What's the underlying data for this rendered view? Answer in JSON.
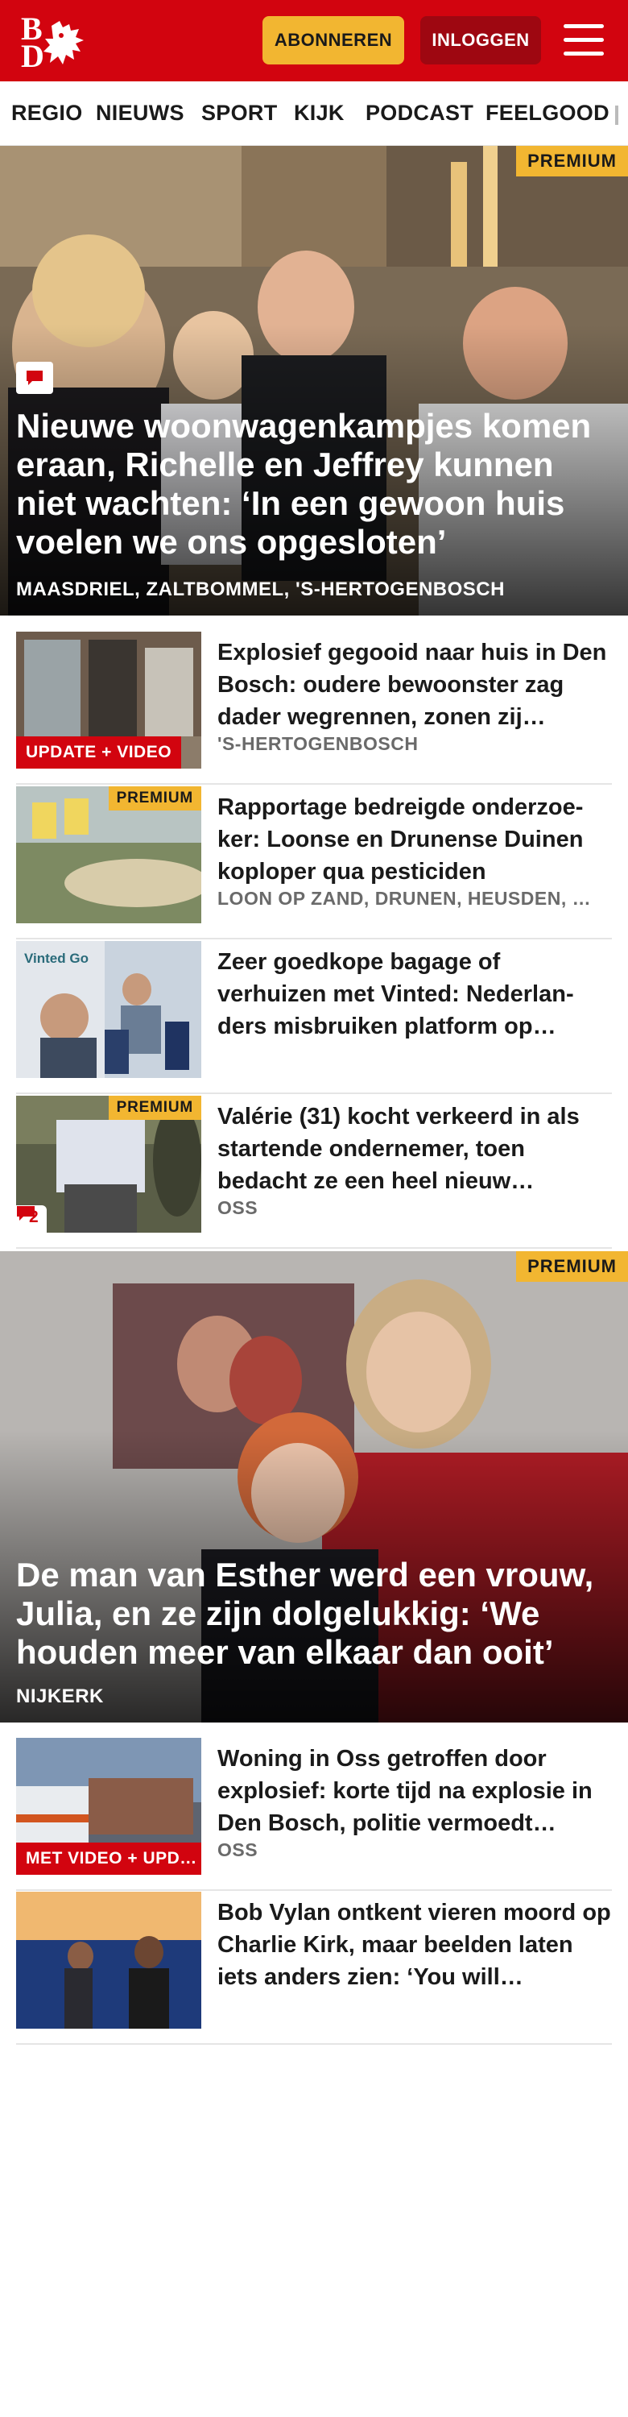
{
  "header": {
    "logo_b": "B",
    "logo_d": "D",
    "subscribe_label": "ABONNEREN",
    "login_label": "INLOGGEN",
    "menu_icon": "hamburger-icon",
    "brand_color": "#d2040f",
    "accent_color": "#f2b631"
  },
  "nav": {
    "items": [
      "REGIO",
      "NIEUWS",
      "SPORT",
      "KIJK",
      "PODCAST",
      "FEELGOOD"
    ]
  },
  "hero1": {
    "badge": "PREMIUM",
    "title": "Nieuwe woonwagenkampjes komen eraan, Richelle en Jeffrey kunnen niet wachten: ‘In een gewoon huis voelen we ons opgesloten’",
    "location": "MAASDRIEL, ZALTBOMMEL, 'S-HERTOGENBOSCH",
    "comment_icon": "comment-icon"
  },
  "list1": [
    {
      "title": "Explosief gegooid naar huis in Den Bosch: oudere bewoonster zag dader wegrennen, zonen zij…",
      "location": "'S-HERTOGENBOSCH",
      "label": "UPDATE + VIDEO"
    },
    {
      "title": "Rapportage bedreigde onderzoe-ker: Loonse en Drunense Duinen koploper qua pesticiden",
      "location": "LOON OP ZAND, DRUNEN, HEUSDEN, …",
      "badge": "PREMIUM"
    },
    {
      "title": "Zeer goedkope bagage of verhuizen met Vinted: Nederlan-ders misbruiken platform op…",
      "thumb_text": "Vinted Go"
    },
    {
      "title": "Valérie (31) kocht verkeerd in als startende ondernemer, toen bedacht ze een heel nieuw…",
      "location": "OSS",
      "badge": "PREMIUM",
      "comments": "2"
    }
  ],
  "hero2": {
    "badge": "PREMIUM",
    "title": "De man van Esther werd een vrouw, Julia, en ze zijn dolgelukkig: ‘We houden meer van elkaar dan ooit’",
    "location": "NIJKERK"
  },
  "list2": [
    {
      "title": "Woning in Oss getroffen door explosief: korte tijd na explosie in Den Bosch, politie vermoedt…",
      "location": "OSS",
      "label": "MET VIDEO + UPD…"
    },
    {
      "title": "Bob Vylan ontkent vieren moord op Charlie Kirk, maar beelden laten iets anders zien: ‘You will…"
    }
  ]
}
